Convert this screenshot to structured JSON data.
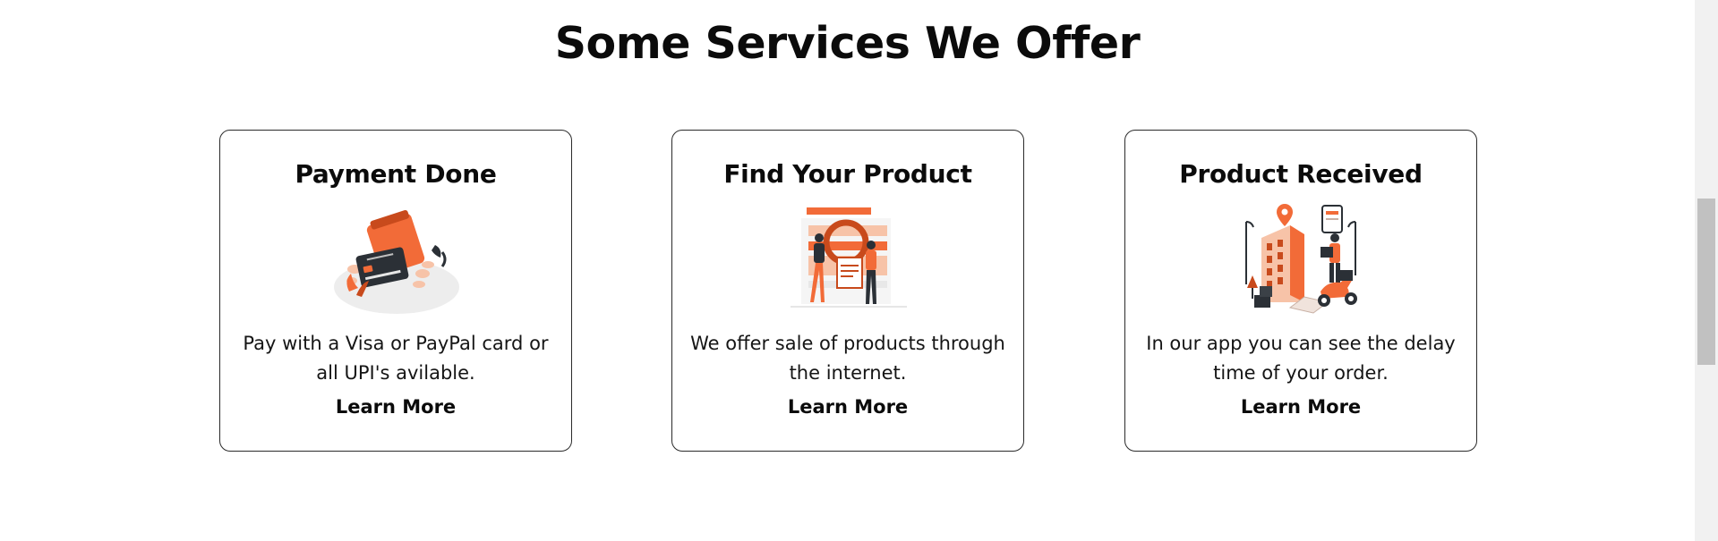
{
  "section": {
    "title": "Some Services We Offer"
  },
  "cards": [
    {
      "title": "Payment Done",
      "description": "Pay with a Visa or PayPal card or all UPI's avilable.",
      "link_label": "Learn More",
      "illustration_icon": "wallet-card-illustration"
    },
    {
      "title": "Find Your Product",
      "description": "We offer sale of products through the internet.",
      "link_label": "Learn More",
      "illustration_icon": "product-search-illustration"
    },
    {
      "title": "Product Received",
      "description": "In our app you can see the delay time of your order.",
      "link_label": "Learn More",
      "illustration_icon": "delivery-illustration"
    }
  ],
  "colors": {
    "accent": "#f26b38",
    "dark": "#2b3036",
    "border": "#2a2a2a"
  }
}
